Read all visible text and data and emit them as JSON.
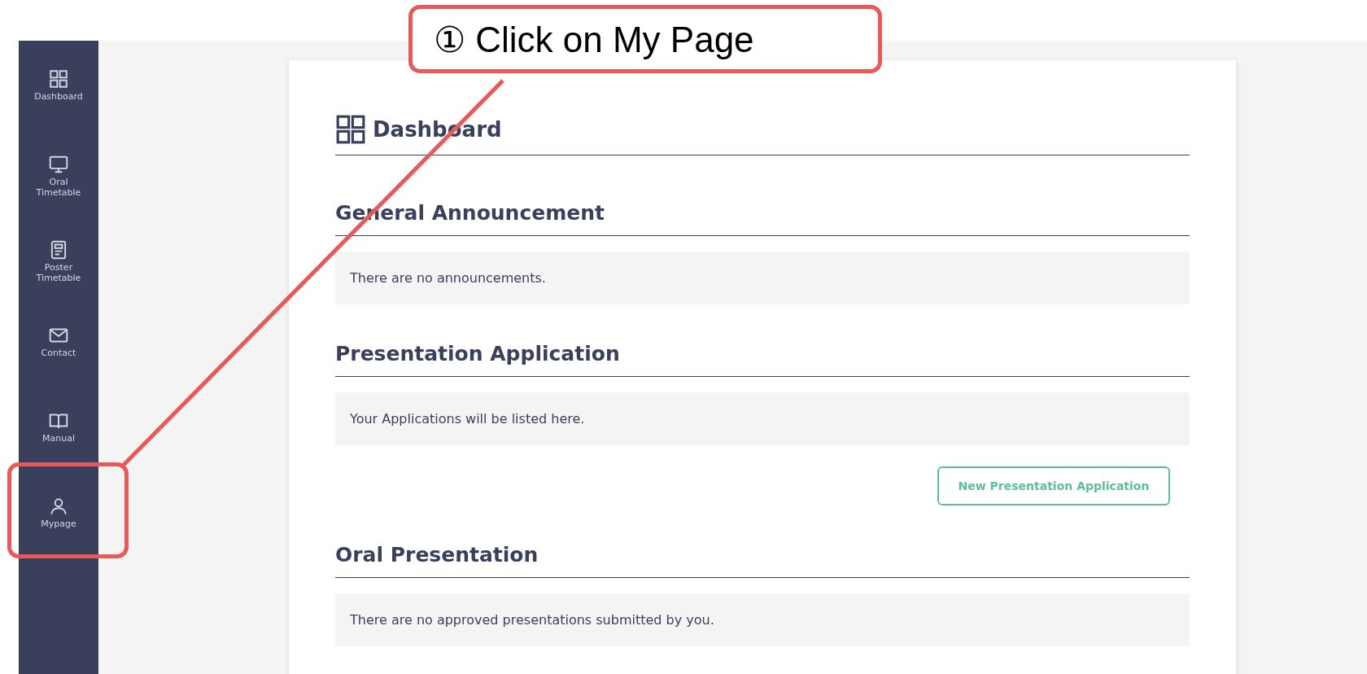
{
  "sidebar": {
    "items": [
      {
        "label": "Dashboard"
      },
      {
        "label": "Oral Timetable"
      },
      {
        "label": "Poster Timetable"
      },
      {
        "label": "Contact"
      },
      {
        "label": "Manual"
      },
      {
        "label": "Mypage"
      }
    ]
  },
  "page_title": "Dashboard",
  "sections": [
    {
      "title": "General Announcement",
      "message": "There are no announcements."
    },
    {
      "title": "Presentation Application",
      "message": "Your Applications will be listed here.",
      "button": "New Presentation Application"
    },
    {
      "title": "Oral Presentation",
      "message": "There are no approved presentations submitted by you."
    }
  ],
  "annotation": {
    "callout": "① Click on My Page"
  }
}
